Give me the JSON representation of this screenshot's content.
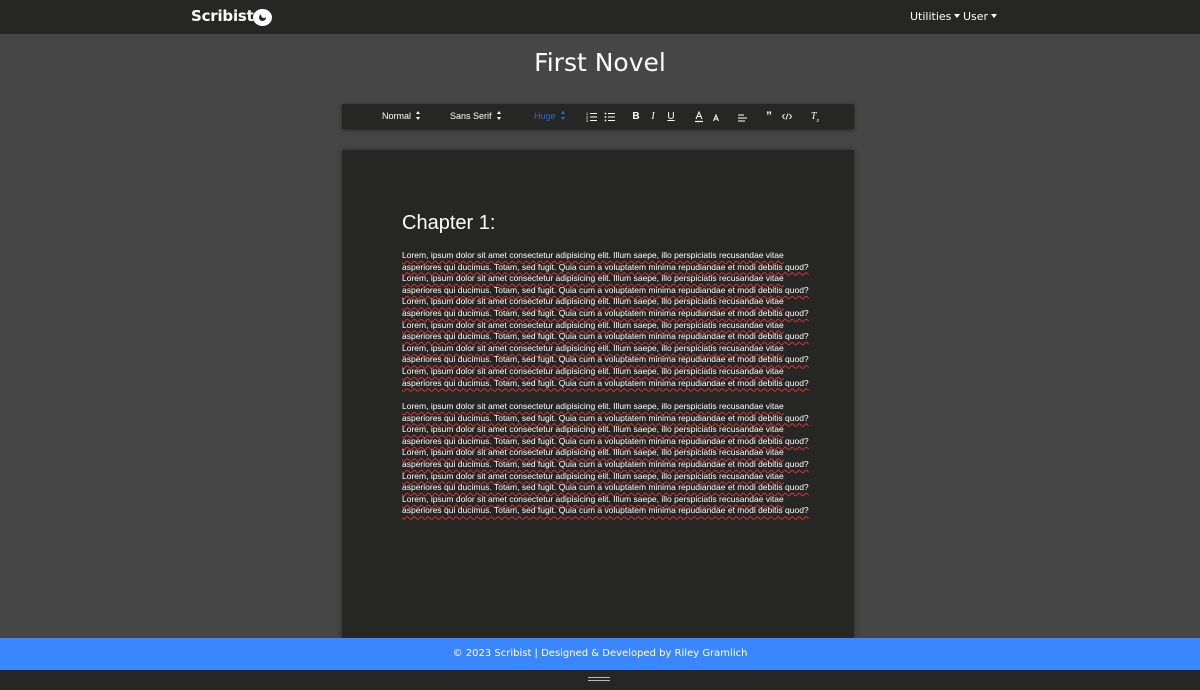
{
  "navbar": {
    "brand": "Scribist",
    "menus": [
      "Utilities",
      "User"
    ]
  },
  "document": {
    "title": "First Novel"
  },
  "toolbar": {
    "header_picker": "Normal",
    "font_picker": "Sans Serif",
    "size_picker": "Huge",
    "buttons": [
      "ordered-list",
      "bullet-list",
      "bold",
      "italic",
      "underline",
      "text-color",
      "background-color",
      "align",
      "blockquote",
      "code-block",
      "clear-formatting"
    ],
    "accent": "#1e6fd9"
  },
  "editor": {
    "heading": "Chapter 1:",
    "line_a": "Lorem, ipsum dolor sit amet consectetur adipisicing elit. Illum saepe, illo perspiciatis recusandae vitae",
    "line_b": "asperiores qui ducimus. Totam, sed fugit. Quia cum a voluptatem minima repudiandae et modi debitis quod?",
    "paragraph_1_repeats": 6,
    "paragraph_2_repeats": 5
  },
  "footer": {
    "text": "© 2023 Scribist | Designed & Developed by Riley Gramlich",
    "color": "#3a86ff"
  }
}
